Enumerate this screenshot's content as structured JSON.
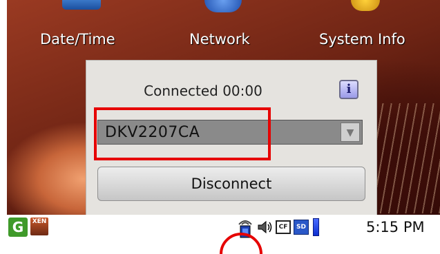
{
  "desktop": {
    "icons": [
      {
        "label": "Date/Time",
        "icon": "clock-icon"
      },
      {
        "label": "Network",
        "icon": "network-icon"
      },
      {
        "label": "System Info",
        "icon": "info-icon"
      }
    ]
  },
  "popup": {
    "status": "Connected 00:00",
    "info_icon": "i",
    "network": "DKV2207CA",
    "disconnect_label": "Disconnect"
  },
  "taskbar": {
    "clock": "5:15 PM",
    "cf_label": "CF",
    "sd_label": "SD",
    "xen_label": "XEN"
  },
  "colors": {
    "highlight": "#e60000",
    "popup_bg": "#e5e3df",
    "selected_bg": "#8a8a8a"
  }
}
